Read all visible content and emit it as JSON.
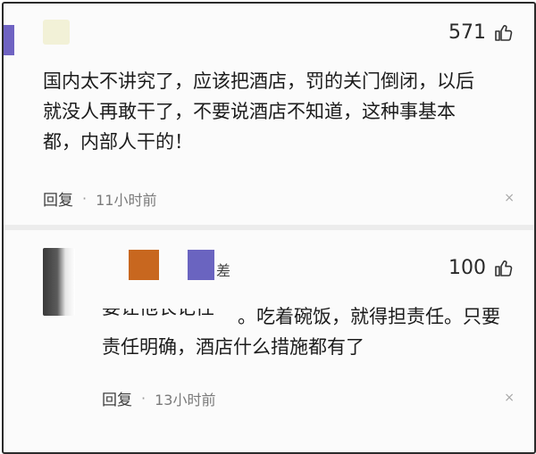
{
  "comments": [
    {
      "likes": "571",
      "text": [
        "国内太不讲究了，应该把酒店，罚的关门倒闭，以后",
        "就没人再敢干了，不要说酒店不知道，这种事基本",
        "都，内部人干的！"
      ],
      "reply_label": "回复",
      "dot": "·",
      "time": "11小时前",
      "close_symbol": "×"
    },
    {
      "likes": "100",
      "name_fragment": "差",
      "clipped_text": "要让他长记性",
      "text_tail": "。吃着碗饭，就得担责任。只要",
      "text": [
        "责任明确，酒店什么措施都有了"
      ],
      "reply_label": "回复",
      "dot": "·",
      "time": "13小时前",
      "close_symbol": "×"
    }
  ]
}
